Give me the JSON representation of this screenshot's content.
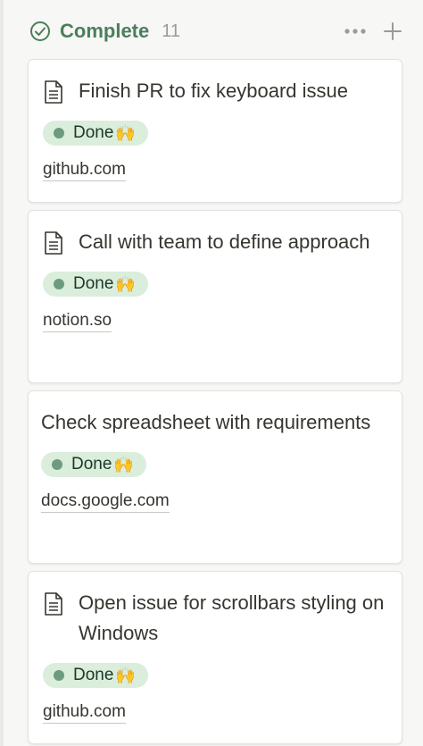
{
  "column": {
    "title": "Complete",
    "count": "11",
    "accent_color": "#4a7f5b"
  },
  "cards": [
    {
      "title": "Finish PR to fix keyboard issue",
      "has_icon": true,
      "status": "Done",
      "status_emoji": "🙌",
      "link": "github.com"
    },
    {
      "title": "Call with team to define approach",
      "has_icon": true,
      "status": "Done",
      "status_emoji": "🙌",
      "link": "notion.so"
    },
    {
      "title": "Check spreadsheet with requirements",
      "has_icon": false,
      "status": "Done",
      "status_emoji": "🙌",
      "link": "docs.google.com"
    },
    {
      "title": "Open issue for scrollbars styling on Windows",
      "has_icon": true,
      "status": "Done",
      "status_emoji": "🙌",
      "link": "github.com"
    }
  ],
  "icons": {
    "column_status": "check-circle-icon",
    "card": "document-icon",
    "more": "more-horizontal-icon",
    "add": "plus-icon"
  },
  "colors": {
    "badge_bg": "#dbeddb",
    "badge_dot": "#6c9b7d"
  }
}
